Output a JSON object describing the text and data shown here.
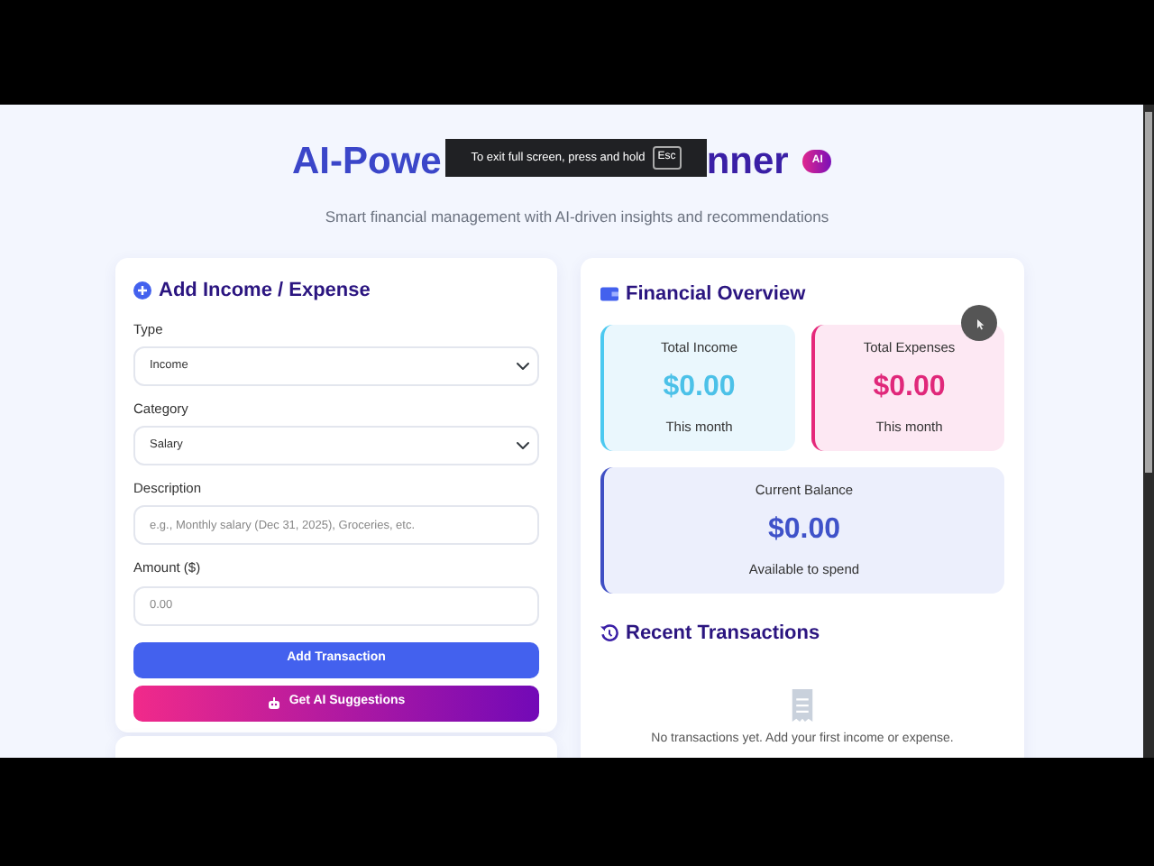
{
  "fullscreen_notice": {
    "text": "To exit full screen, press and hold",
    "key": "Esc"
  },
  "header": {
    "title_start": "AI-Powe",
    "title_end": "nner",
    "badge": "AI",
    "subtitle": "Smart financial management with AI-driven insights and recommendations"
  },
  "form": {
    "title": "Add Income / Expense",
    "fields": [
      {
        "kind": "select",
        "label": "Type",
        "value": "Income"
      },
      {
        "kind": "select",
        "label": "Category",
        "value": "Salary"
      },
      {
        "kind": "input",
        "label": "Description",
        "placeholder": "e.g., Monthly salary (Dec 31, 2025), Groceries, etc."
      },
      {
        "kind": "input",
        "label": "Amount ($)",
        "placeholder": "0.00"
      }
    ],
    "buttons": [
      {
        "kind": "primary",
        "label": "Add Transaction"
      },
      {
        "kind": "ai",
        "label": "Get AI Suggestions"
      }
    ]
  },
  "overview": {
    "title": "Financial Overview",
    "stats": [
      {
        "kind": "income",
        "label": "Total Income",
        "amount": "$0.00",
        "note": "This month"
      },
      {
        "kind": "expense",
        "label": "Total Expenses",
        "amount": "$0.00",
        "note": "This month"
      },
      {
        "kind": "balance",
        "label": "Current Balance",
        "amount": "$0.00",
        "note": "Available to spend"
      }
    ],
    "recent_title": "Recent Transactions",
    "empty_text": "No transactions yet. Add your first income or expense."
  }
}
